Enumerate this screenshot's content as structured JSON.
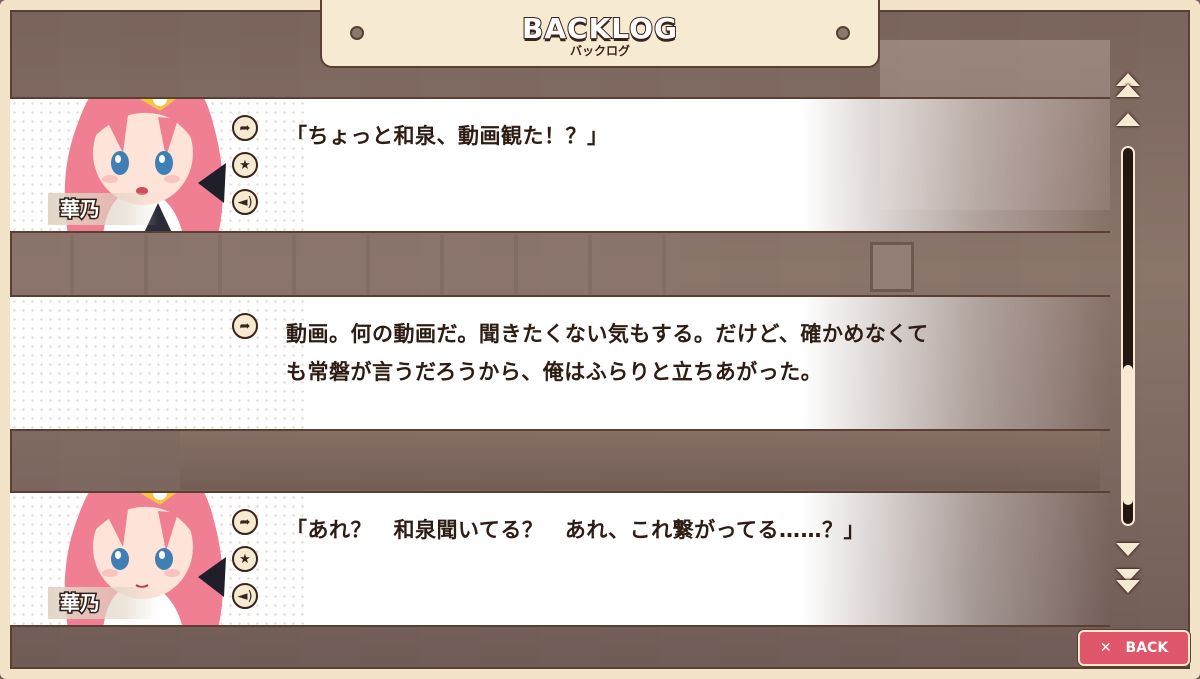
{
  "header": {
    "title": "BACKLOG",
    "subtitle": "バックログ"
  },
  "entries": [
    {
      "speaker": "華乃",
      "has_portrait": true,
      "text": "「ちょっと和泉、動画観た！？」",
      "actions": [
        "jump-icon",
        "star-icon",
        "voice-icon"
      ]
    },
    {
      "speaker": "",
      "has_portrait": false,
      "text": "動画。何の動画だ。聞きたくない気もする。だけど、確かめなくても常磐が言うだろうから、俺はふらりと立ちあがった。",
      "actions": [
        "jump-icon"
      ]
    },
    {
      "speaker": "華乃",
      "has_portrait": true,
      "text": "「あれ？　和泉聞いてる？　あれ、これ繋がってる……？」",
      "actions": [
        "jump-icon",
        "star-icon",
        "voice-icon"
      ]
    }
  ],
  "scroll": {
    "position": 0.92
  },
  "back_button": {
    "label": "BACK",
    "icon": "close-icon"
  },
  "colors": {
    "frame": "#f3e3c8",
    "outline": "#5a3f32",
    "back_button": "#e0566a",
    "text": "#2e1d15",
    "hair": "#f07f93"
  }
}
